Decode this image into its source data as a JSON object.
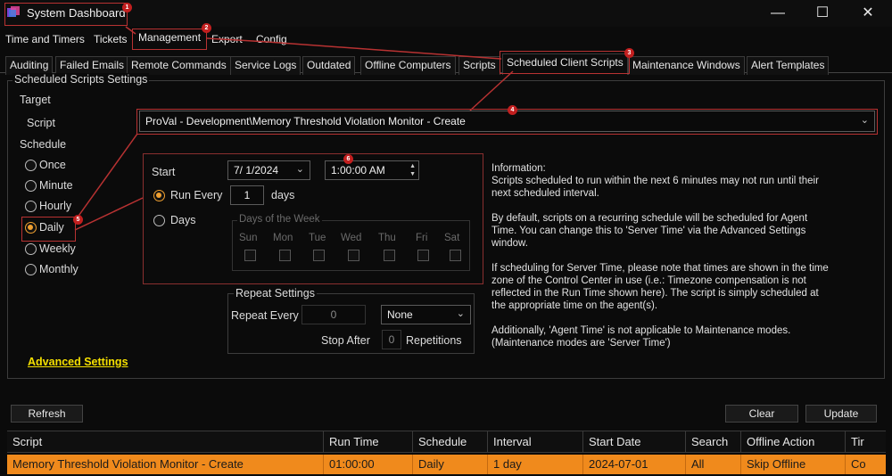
{
  "window": {
    "title": "System Dashboard",
    "minimize_glyph": "—",
    "maximize_glyph": "☐",
    "close_glyph": "✕"
  },
  "menu": [
    "Time and Timers",
    "Tickets",
    "Management",
    "Export",
    "Config"
  ],
  "tabs": [
    "Auditing",
    "Failed Emails",
    "Remote Commands",
    "Service Logs",
    "Outdated",
    "Offline Computers",
    "Scripts",
    "Scheduled Client Scripts",
    "Maintenance Windows",
    "Alert Templates"
  ],
  "settings": {
    "title": "Scheduled Scripts Settings",
    "target_label": "Target",
    "script_label": "Script",
    "script_value": "ProVal - Development\\Memory Threshold Violation Monitor - Create",
    "schedule_label": "Schedule",
    "schedule_options": [
      "Once",
      "Minute",
      "Hourly",
      "Daily",
      "Weekly",
      "Monthly"
    ],
    "selected_schedule": "Daily"
  },
  "daily": {
    "start_label": "Start",
    "start_date": "7/  1/2024",
    "start_time": "1:00:00 AM",
    "run_every_label": "Run Every",
    "run_every_value": "1",
    "days_unit": "days",
    "days_label": "Days",
    "days_of_week_label": "Days of the Week",
    "weekdays": [
      "Sun",
      "Mon",
      "Tue",
      "Wed",
      "Thu",
      "Fri",
      "Sat"
    ]
  },
  "repeat": {
    "title": "Repeat Settings",
    "repeat_every_label": "Repeat Every",
    "repeat_every_value": "0",
    "unit_value": "None",
    "stop_after_label": "Stop After",
    "stop_after_value": "0",
    "repetitions_label": "Repetitions"
  },
  "advanced_link": "Advanced Settings",
  "info": [
    "Information:\nScripts scheduled to run within the next 6 minutes may not run until their next scheduled interval.",
    "By default, scripts on a recurring schedule will be scheduled for Agent Time. You can change this to 'Server Time' via the Advanced Settings window.",
    "If scheduling for Server Time, please note that times are shown in the time zone of the Control Center in use (i.e.: Timezone compensation is not reflected in the Run Time shown here). The script is simply scheduled at the appropriate time on the agent(s).",
    "Additionally, 'Agent Time' is not applicable to Maintenance modes. (Maintenance modes are 'Server Time')"
  ],
  "buttons": {
    "refresh": "Refresh",
    "clear": "Clear",
    "update": "Update"
  },
  "table": {
    "columns": [
      "Script",
      "Run Time",
      "Schedule",
      "Interval",
      "Start Date",
      "Search",
      "Offline Action",
      "Tir"
    ],
    "rows": [
      [
        "Memory Threshold Violation Monitor - Create",
        "01:00:00",
        "Daily",
        "1 day",
        "2024-07-01",
        "All",
        "Skip Offline",
        "Co"
      ]
    ]
  },
  "annotations": [
    "1",
    "2",
    "3",
    "4",
    "5",
    "6"
  ],
  "colors": {
    "accent": "#f08a1c",
    "annotation": "#c21f1f",
    "link": "#f5e000"
  }
}
